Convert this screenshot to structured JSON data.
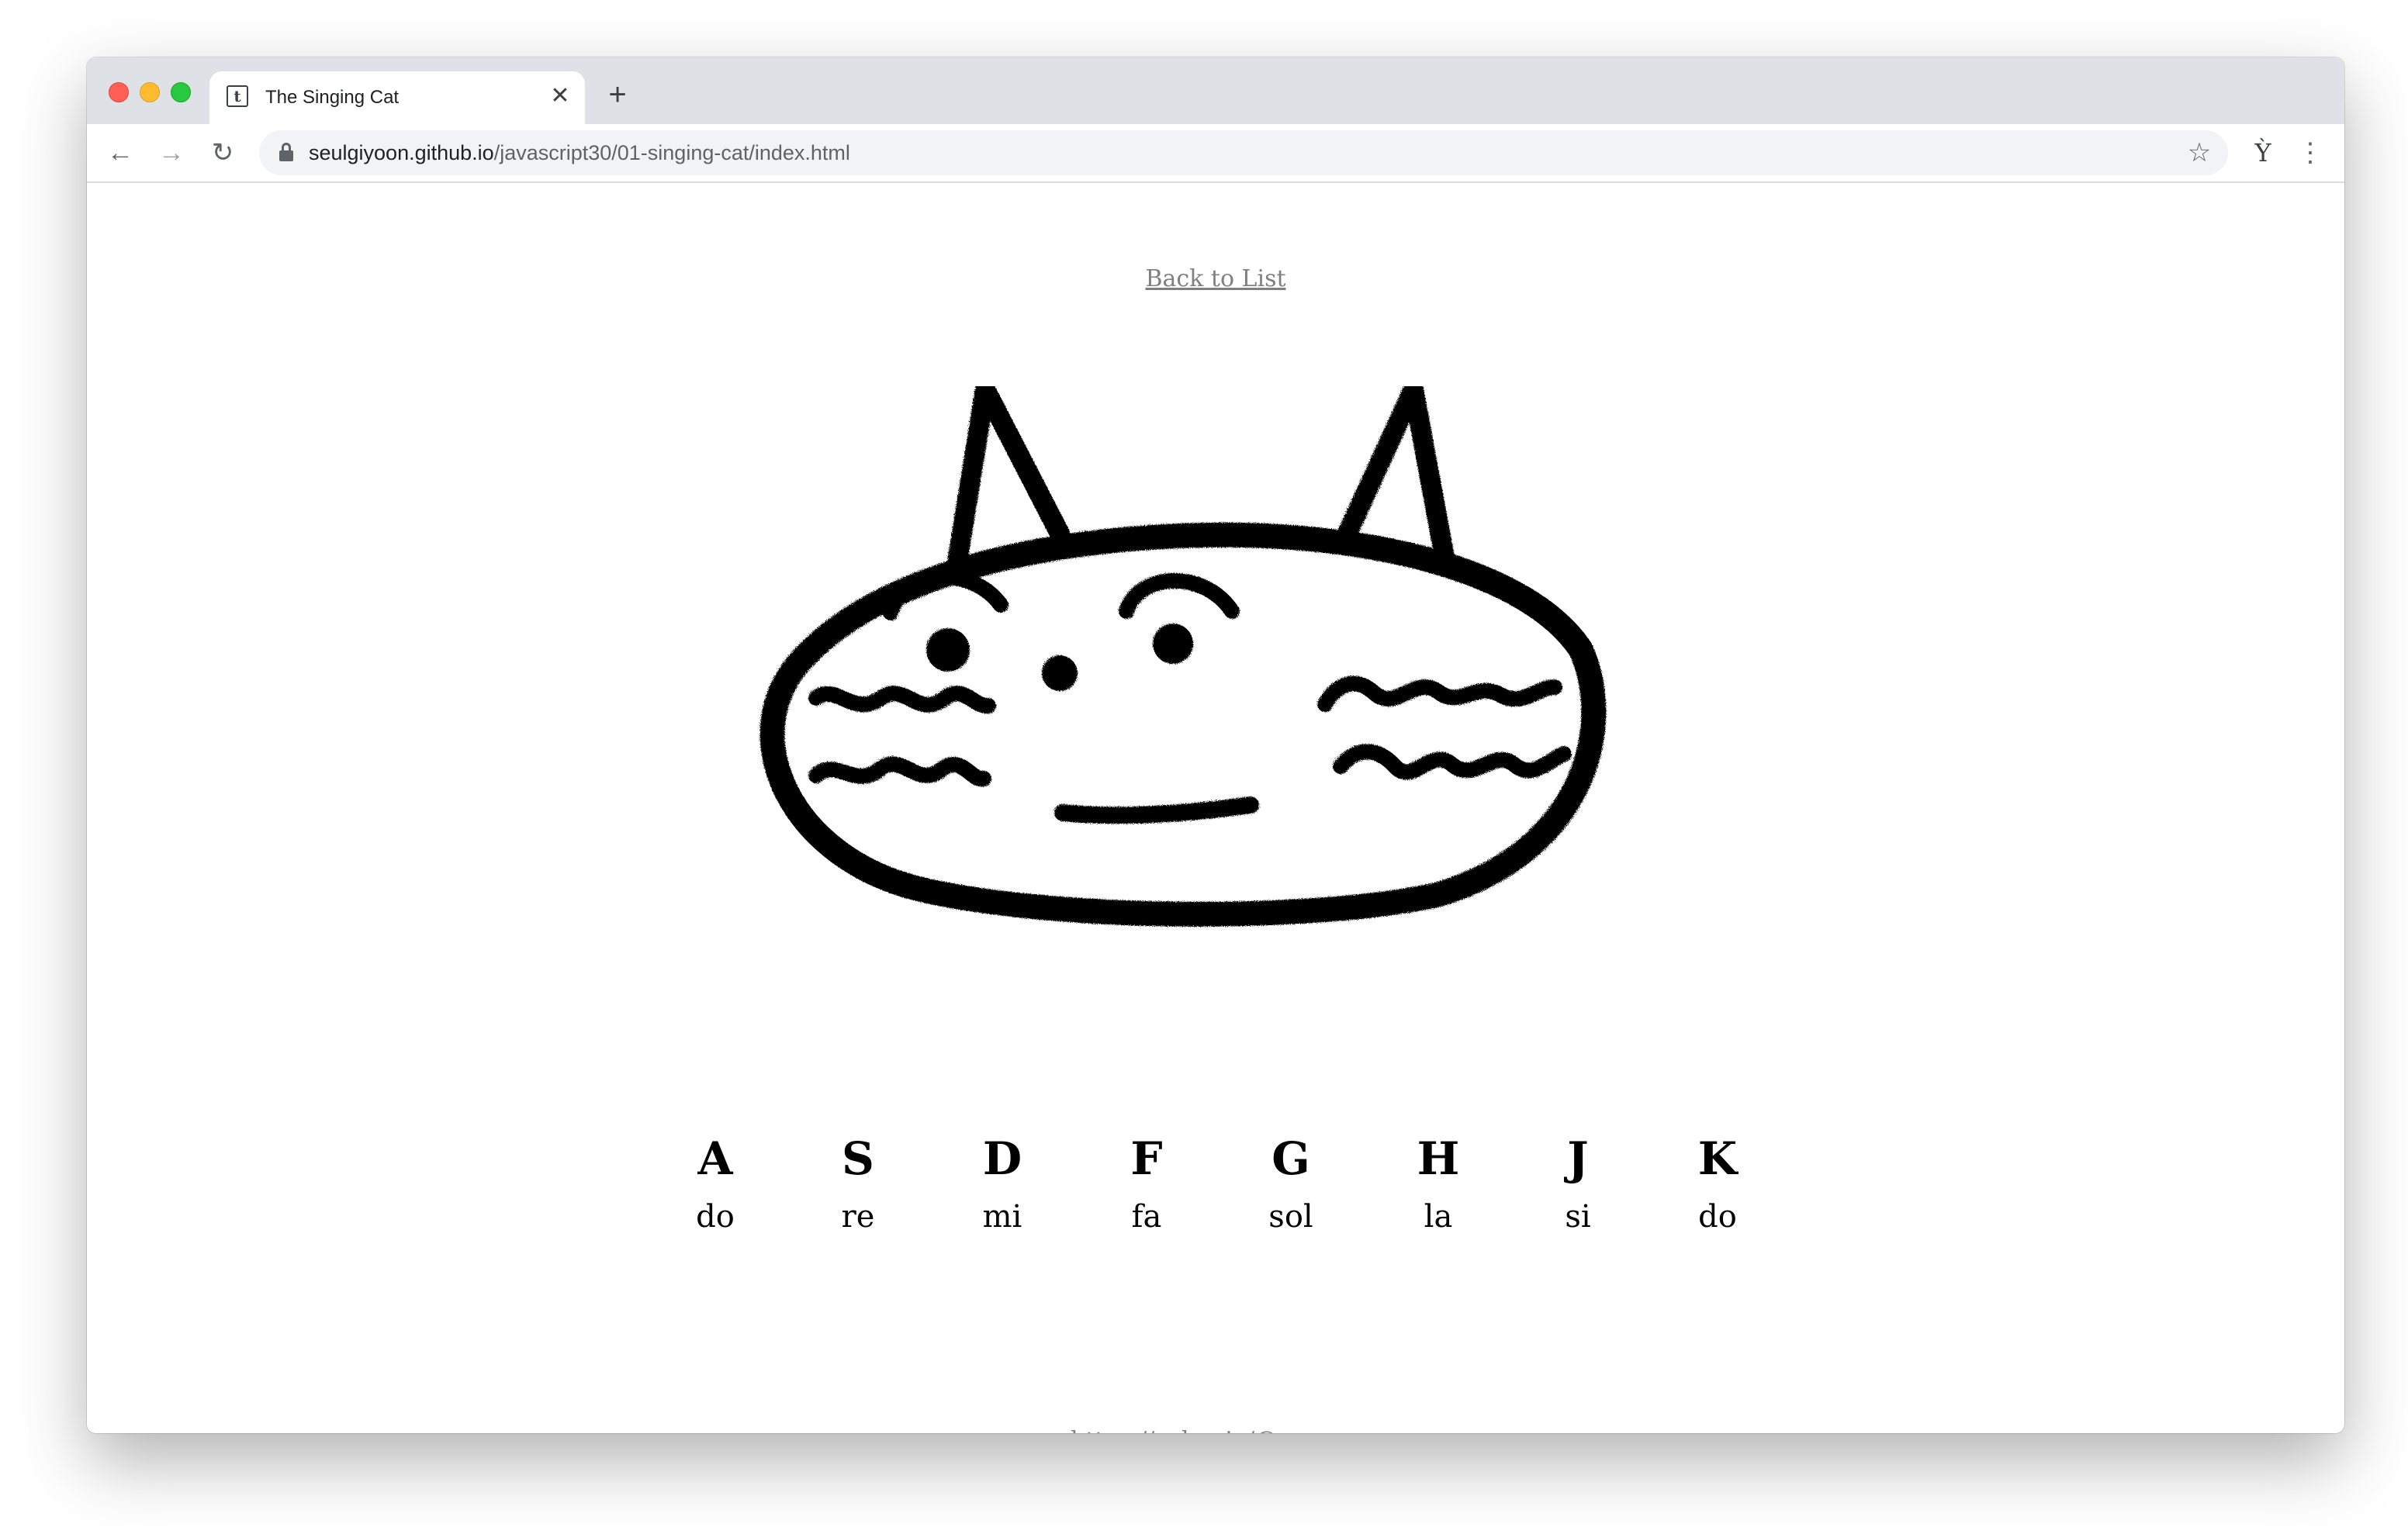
{
  "browser": {
    "tab": {
      "title": "The Singing Cat",
      "favicon": "t"
    },
    "new_tab_icon": "+",
    "close_icon": "✕",
    "address_bar": {
      "host": "seulgiyoon.github.io",
      "path": "/javascript30/01-singing-cat/index.html"
    },
    "icons": {
      "back": "←",
      "forward": "→",
      "reload": "↻",
      "bookmark": "☆",
      "extension": "Ỳ",
      "menu": "⋮"
    }
  },
  "page": {
    "back_link": "Back to List",
    "keys": [
      {
        "letter": "A",
        "note": "do"
      },
      {
        "letter": "S",
        "note": "re"
      },
      {
        "letter": "D",
        "note": "mi"
      },
      {
        "letter": "F",
        "note": "fa"
      },
      {
        "letter": "G",
        "note": "sol"
      },
      {
        "letter": "H",
        "note": "la"
      },
      {
        "letter": "J",
        "note": "si"
      },
      {
        "letter": "K",
        "note": "do"
      }
    ],
    "footer_link": "https://velog.io/@sgyoon"
  }
}
